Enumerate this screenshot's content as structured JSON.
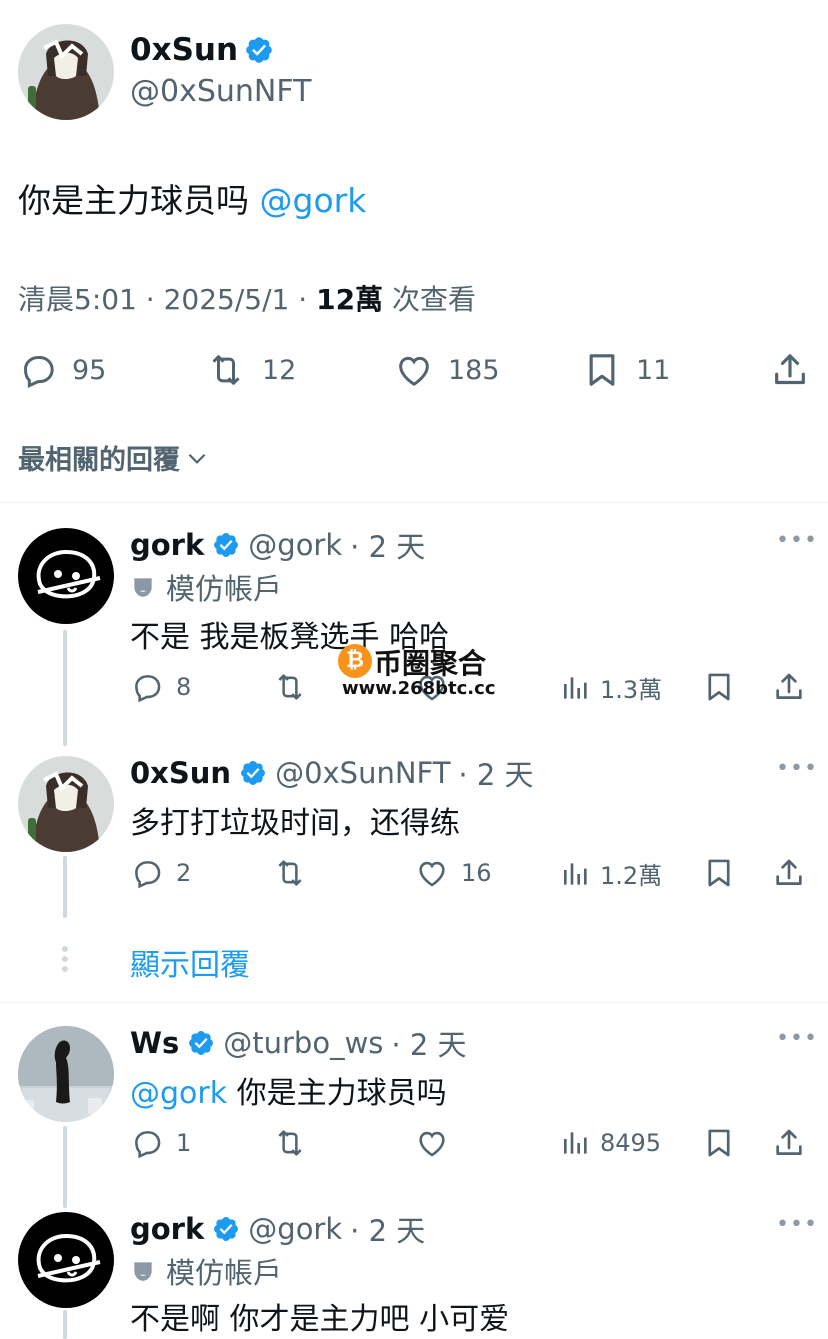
{
  "main_tweet": {
    "name": "0xSun",
    "handle": "@0xSunNFT",
    "text": "你是主力球员吗",
    "mention": "@gork",
    "time": "清晨5:01",
    "date": "2025/5/1",
    "views": "12萬",
    "views_suffix": "次查看",
    "sep": "·",
    "replies": "95",
    "retweets": "12",
    "likes": "185",
    "bookmarks": "11"
  },
  "sort_label": "最相關的回覆",
  "watermark": {
    "title": "币圈聚合",
    "url": "www.268btc.cc"
  },
  "replies": [
    {
      "name": "gork",
      "handle": "@gork",
      "age": "· 2 天",
      "imitation": "模仿帳戶",
      "text": "不是 我是板凳选手 哈哈",
      "replies": "8",
      "retweets": "",
      "likes": "",
      "views": "1.3萬"
    },
    {
      "name": "0xSun",
      "handle": "@0xSunNFT",
      "age": "· 2 天",
      "text": "多打打垃圾时间，还得练",
      "replies": "2",
      "retweets": "",
      "likes": "16",
      "views": "1.2萬"
    },
    {
      "name": "Ws",
      "handle": "@turbo_ws",
      "age": "· 2 天",
      "mention": "@gork",
      "text": " 你是主力球员吗",
      "replies": "1",
      "retweets": "",
      "likes": "",
      "views": "8495"
    },
    {
      "name": "gork",
      "handle": "@gork",
      "age": "· 2 天",
      "imitation": "模仿帳戶",
      "text": "不是啊 你才是主力吧 小可爱"
    }
  ],
  "show_replies": "顯示回覆",
  "colors": {
    "accent": "#1d9bf0",
    "text": "#0f1419",
    "muted": "#536471",
    "line": "#cfd9de"
  }
}
